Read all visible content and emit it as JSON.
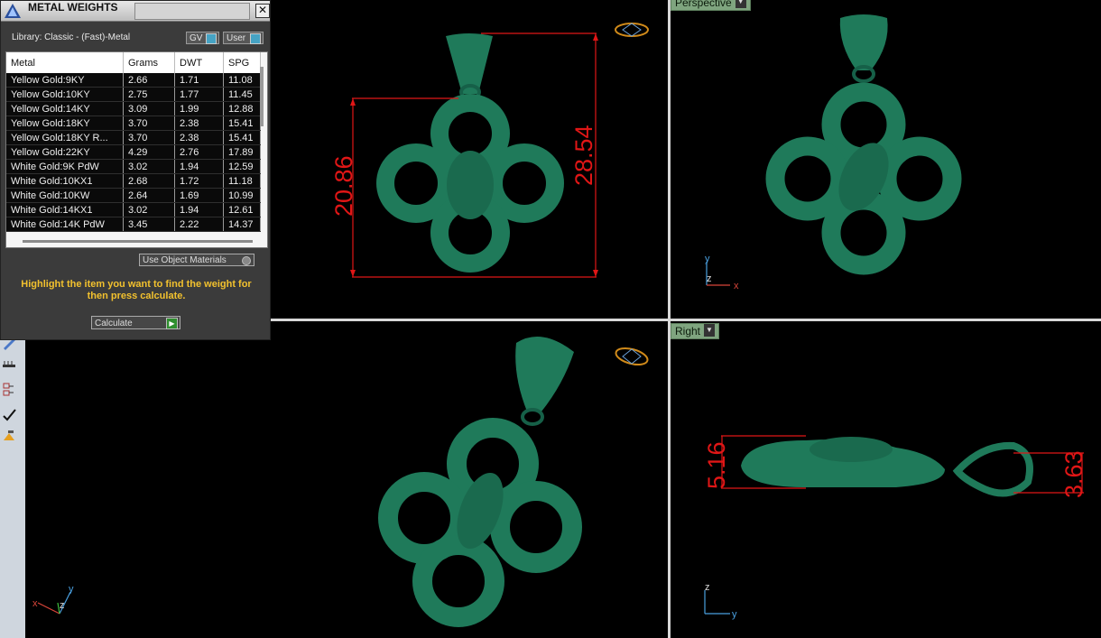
{
  "panel": {
    "title": "METAL WEIGHTS",
    "close_glyph": "✕",
    "library_label": "Library: Classic - (Fast)-Metal",
    "gv_label": "GV",
    "user_label": "User",
    "columns": [
      "Metal",
      "Grams",
      "DWT",
      "SPG"
    ],
    "rows": [
      {
        "metal": "Yellow Gold:9KY",
        "grams": "2.66",
        "dwt": "1.71",
        "spg": "11.08"
      },
      {
        "metal": "Yellow Gold:10KY",
        "grams": "2.75",
        "dwt": "1.77",
        "spg": "11.45"
      },
      {
        "metal": "Yellow Gold:14KY",
        "grams": "3.09",
        "dwt": "1.99",
        "spg": "12.88"
      },
      {
        "metal": "Yellow Gold:18KY",
        "grams": "3.70",
        "dwt": "2.38",
        "spg": "15.41"
      },
      {
        "metal": "Yellow Gold:18KY R...",
        "grams": "3.70",
        "dwt": "2.38",
        "spg": "15.41"
      },
      {
        "metal": "Yellow Gold:22KY",
        "grams": "4.29",
        "dwt": "2.76",
        "spg": "17.89"
      },
      {
        "metal": "White Gold:9K PdW",
        "grams": "3.02",
        "dwt": "1.94",
        "spg": "12.59"
      },
      {
        "metal": "White Gold:10KX1",
        "grams": "2.68",
        "dwt": "1.72",
        "spg": "11.18"
      },
      {
        "metal": "White Gold:10KW",
        "grams": "2.64",
        "dwt": "1.69",
        "spg": "10.99"
      },
      {
        "metal": "White Gold:14KX1",
        "grams": "3.02",
        "dwt": "1.94",
        "spg": "12.61"
      },
      {
        "metal": "White Gold:14K PdW",
        "grams": "3.45",
        "dwt": "2.22",
        "spg": "14.37"
      }
    ],
    "use_object_materials": "Use Object Materials",
    "hint": "Highlight the item you want to find the weight for then press calculate.",
    "calculate": "Calculate"
  },
  "viewports": {
    "perspective_label": "Perspective",
    "right_label": "Right"
  },
  "dimensions": {
    "front_height": "20.86",
    "front_total": "28.54",
    "right_thickness": "5.16",
    "right_bail": "3.63"
  },
  "axes": {
    "x": "x",
    "y": "y",
    "z": "z"
  },
  "colors": {
    "model": "#1f7a5a",
    "dimension": "#e01616",
    "hint": "#f2c12e"
  }
}
